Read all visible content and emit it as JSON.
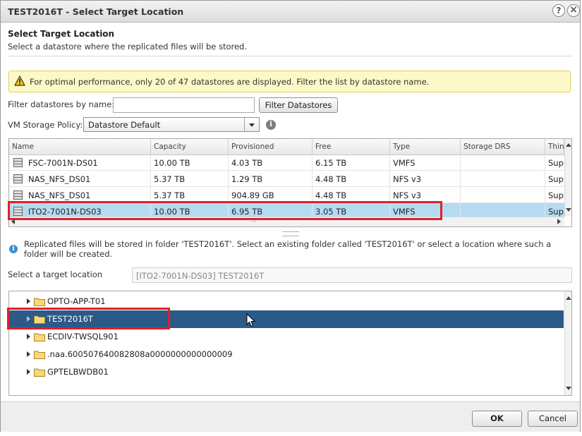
{
  "dialog": {
    "title": "TEST2016T - Select Target Location",
    "help_label": "?",
    "close_label": "×"
  },
  "header": {
    "title": "Select Target Location",
    "subtitle": "Select a datastore where the replicated files will be stored."
  },
  "warning": {
    "text": "For optimal performance, only 20 of 47 datastores are displayed. Filter the list by datastore name."
  },
  "filter": {
    "label": "Filter datastores by name:",
    "value": "",
    "button_label": "Filter Datastores"
  },
  "policy": {
    "label": "VM Storage Policy:",
    "selected": "Datastore Default",
    "info_glyph": "i"
  },
  "datastores": {
    "columns": [
      "Name",
      "Capacity",
      "Provisioned",
      "Free",
      "Type",
      "Storage DRS",
      "Thin"
    ],
    "rows": [
      {
        "name": "FSC-7001N-DS01",
        "capacity": "10.00 TB",
        "provisioned": "4.03 TB",
        "free": "6.15 TB",
        "type": "VMFS",
        "drs": "",
        "thin": "Sup"
      },
      {
        "name": "NAS_NFS_DS01",
        "capacity": "5.37 TB",
        "provisioned": "1.29 TB",
        "free": "4.48 TB",
        "type": "NFS v3",
        "drs": "",
        "thin": "Sup"
      },
      {
        "name": "NAS_NFS_DS01",
        "capacity": "5.37 TB",
        "provisioned": "904.89 GB",
        "free": "4.48 TB",
        "type": "NFS v3",
        "drs": "",
        "thin": "Sup"
      },
      {
        "name": "ITO2-7001N-DS03",
        "capacity": "10.00 TB",
        "provisioned": "6.95 TB",
        "free": "3.05 TB",
        "type": "VMFS",
        "drs": "",
        "thin": "Sup"
      }
    ],
    "selected_index": 3
  },
  "replication_info": {
    "text": "Replicated files will be stored in folder 'TEST2016T'. Select an existing folder called 'TEST2016T' or select a location where such a folder will be created."
  },
  "target": {
    "label": "Select a target location",
    "value": "[ITO2-7001N-DS03] TEST2016T"
  },
  "folders": {
    "items": [
      "OPTO-APP-T01",
      "TEST2016T",
      "ECDIV-TWSQL901",
      ".naa.600507640082808a0000000000000009",
      "GPTELBWDB01"
    ],
    "selected_index": 1
  },
  "footer": {
    "ok_label": "OK",
    "cancel_label": "Cancel"
  },
  "colors": {
    "selection_row": "#b5dbf3",
    "selection_tree": "#2c5a88",
    "highlight_box": "#e0202a",
    "warning_bg": "#fdf9c6"
  }
}
